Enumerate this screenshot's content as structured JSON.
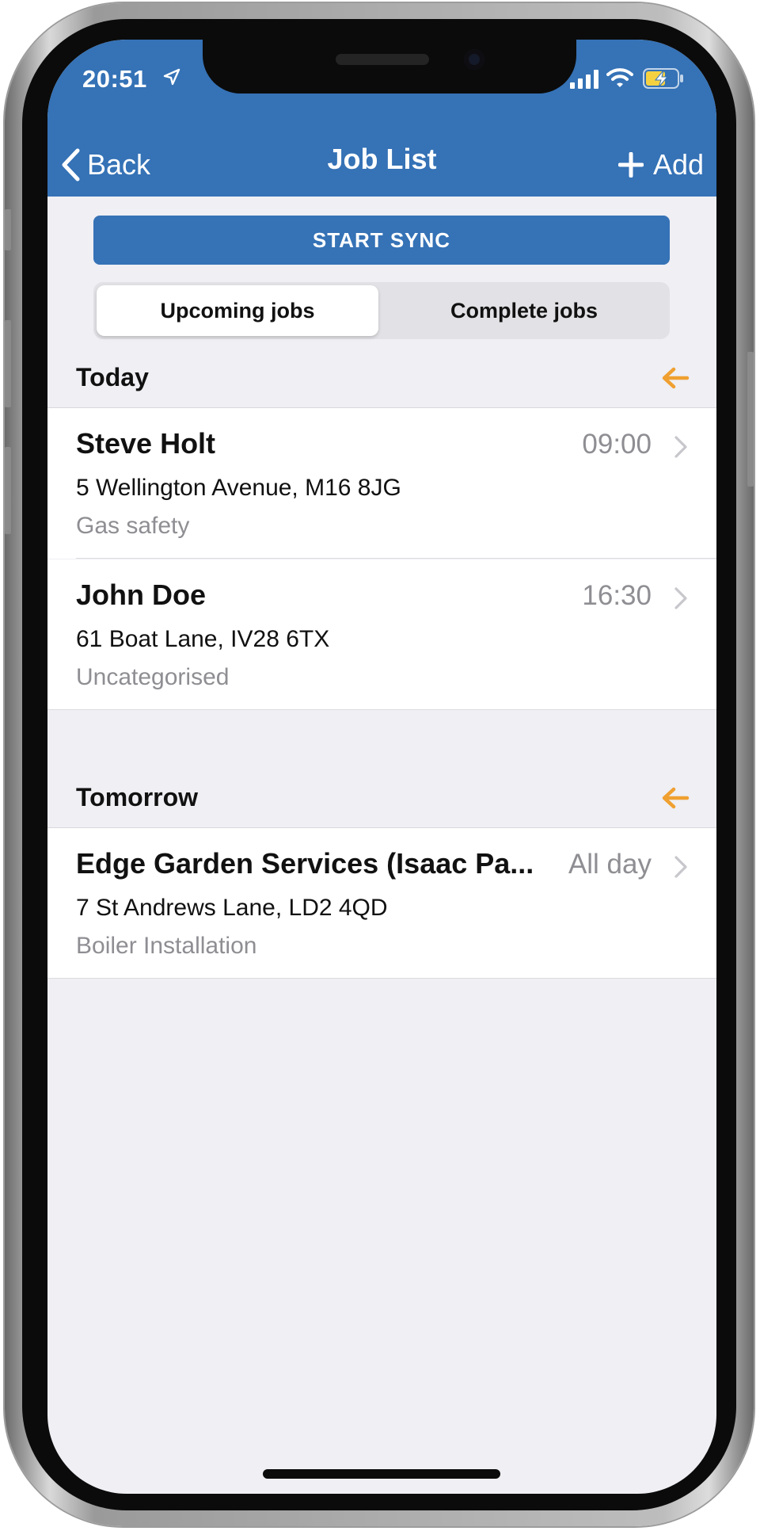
{
  "status_bar": {
    "time": "20:51",
    "icons": [
      "location-arrow-icon",
      "cellular-signal-icon",
      "wifi-icon",
      "battery-charging-icon"
    ]
  },
  "nav": {
    "back_label": "Back",
    "title": "Job List",
    "add_label": "Add",
    "background_color": "#3572b6"
  },
  "sync_button": {
    "label": "START SYNC"
  },
  "segments": {
    "items": [
      "Upcoming jobs",
      "Complete jobs"
    ],
    "selected": "Upcoming jobs"
  },
  "sections": [
    {
      "title": "Today",
      "arrow_icon": "arrow-left-icon",
      "arrow_color": "#f0a030",
      "jobs": [
        {
          "name": "Steve Holt",
          "time": "09:00",
          "address": "5 Wellington Avenue, M16 8JG",
          "type": "Gas safety"
        },
        {
          "name": "John Doe",
          "time": "16:30",
          "address": "61 Boat Lane, IV28 6TX",
          "type": "Uncategorised"
        }
      ]
    },
    {
      "title": "Tomorrow",
      "arrow_icon": "arrow-left-icon",
      "arrow_color": "#f0a030",
      "jobs": [
        {
          "name": "Edge Garden Services (Isaac Pa...",
          "time": "All day",
          "address": "7 St Andrews Lane, LD2 4QD",
          "type": "Boiler Installation"
        }
      ]
    }
  ]
}
